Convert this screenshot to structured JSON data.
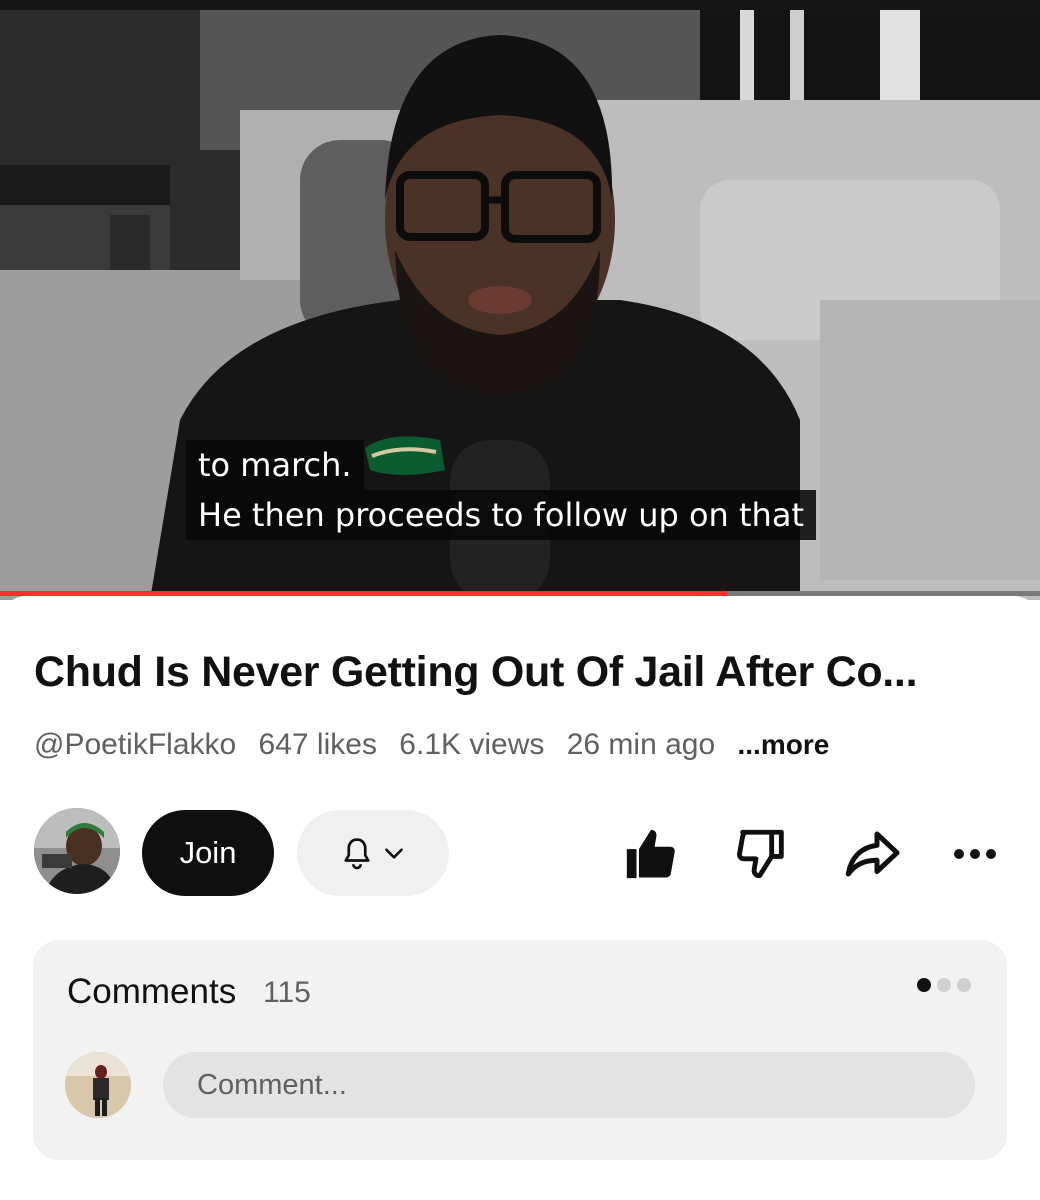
{
  "video": {
    "caption_line_1": "to march.",
    "caption_line_2": "He then proceeds to follow up on that",
    "progress_fraction": 0.7,
    "progress_color": "#ff2d2d"
  },
  "details": {
    "title": "Chud Is Never Getting Out Of Jail After Co...",
    "channel_handle": "@PoetikFlakko",
    "likes": "647 likes",
    "views": "6.1K views",
    "age": "26 min ago",
    "more_label": "...more"
  },
  "actions": {
    "join_label": "Join",
    "icons": [
      "avatar",
      "bell-icon",
      "chevron-down-icon",
      "thumbs-up-icon",
      "thumbs-down-icon",
      "share-icon",
      "more-icon"
    ]
  },
  "comments": {
    "title": "Comments",
    "count": "115",
    "input_placeholder": "Comment...",
    "pager_active_index": 0,
    "pager_total": 3
  }
}
